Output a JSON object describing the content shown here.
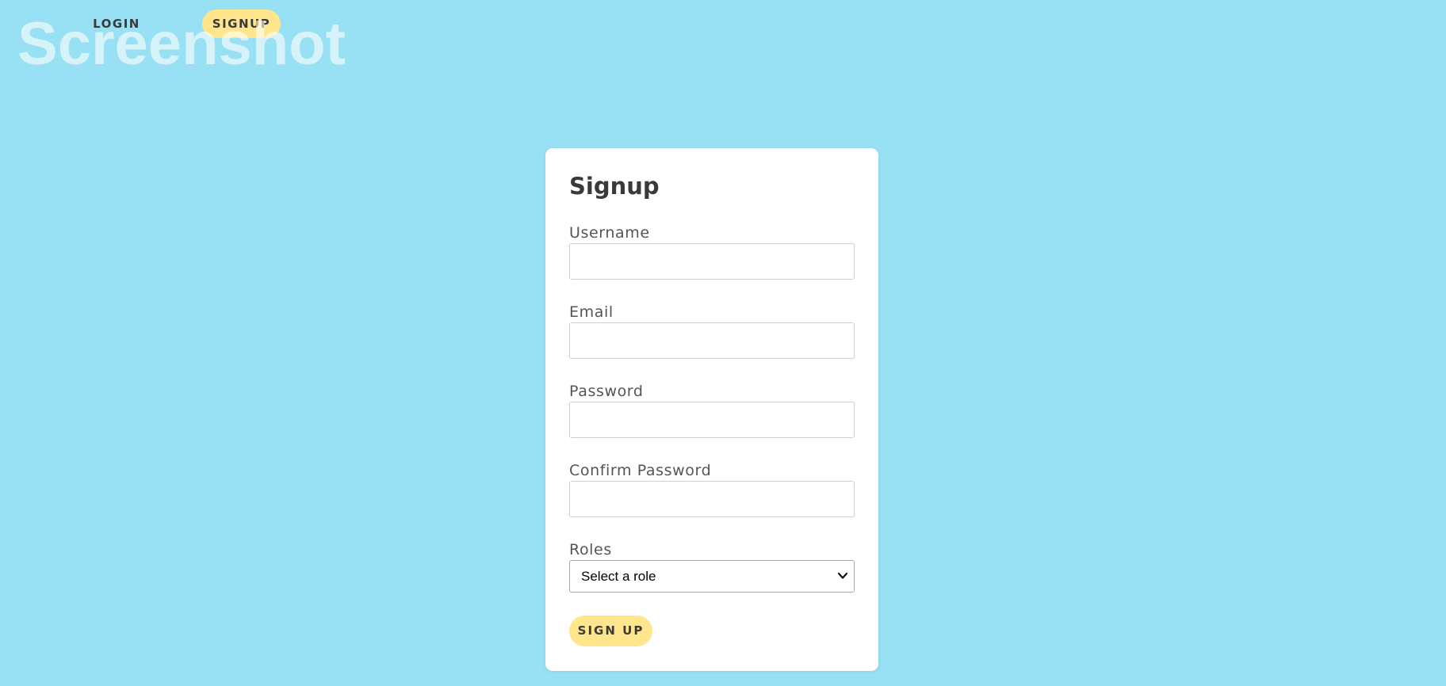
{
  "nav": {
    "login_label": "LOGIN",
    "signup_label": "SIGNUP"
  },
  "watermark": "Screenshot",
  "form": {
    "title": "Signup",
    "fields": [
      {
        "label": "Username",
        "value": "",
        "placeholder": ""
      },
      {
        "label": "Email",
        "value": "",
        "placeholder": ""
      },
      {
        "label": "Password",
        "value": "",
        "placeholder": ""
      },
      {
        "label": "Confirm Password",
        "value": "",
        "placeholder": ""
      }
    ],
    "roles": {
      "label": "Roles",
      "selected": "Select a role"
    },
    "submit_label": "SIGN UP"
  },
  "colors": {
    "background": "#98e0f3",
    "accent": "#ffe58c",
    "card": "#ffffff",
    "text": "#3a3a3a"
  },
  "icons": {
    "select_arrow": "chevron-down-icon"
  }
}
